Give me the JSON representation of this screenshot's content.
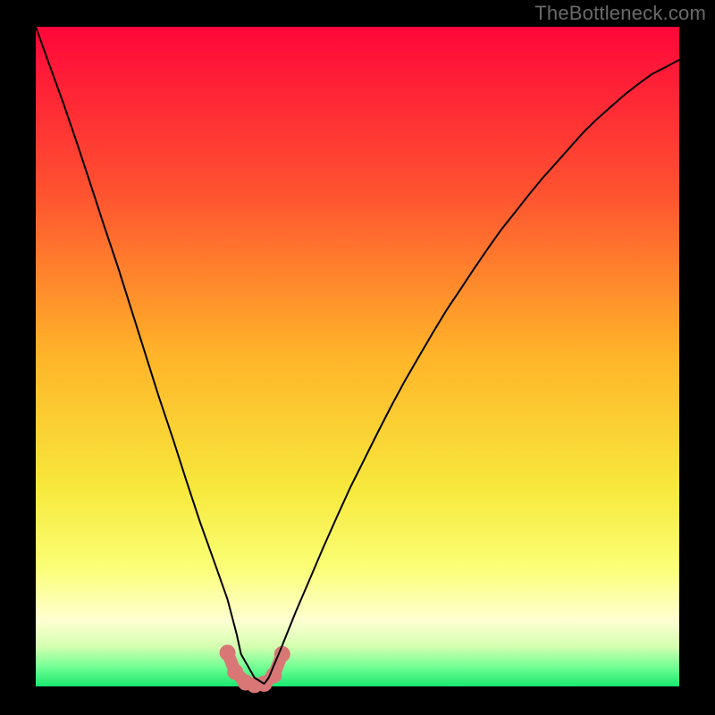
{
  "attribution": "TheBottleneck.com",
  "chart_data": {
    "type": "line",
    "title": "",
    "xlabel": "",
    "ylabel": "",
    "xlim": [
      0,
      100
    ],
    "ylim": [
      0,
      100
    ],
    "grid": false,
    "background_gradient": {
      "stops": [
        {
          "offset": 0.0,
          "color": "#ff063a"
        },
        {
          "offset": 0.25,
          "color": "#ff5230"
        },
        {
          "offset": 0.5,
          "color": "#ffb529"
        },
        {
          "offset": 0.7,
          "color": "#f7e83c"
        },
        {
          "offset": 0.82,
          "color": "#fbff76"
        },
        {
          "offset": 0.9,
          "color": "#feffd1"
        },
        {
          "offset": 0.94,
          "color": "#d3ffb0"
        },
        {
          "offset": 0.97,
          "color": "#74ff94"
        },
        {
          "offset": 1.0,
          "color": "#17e86f"
        }
      ]
    },
    "series": [
      {
        "name": "bottleneck-curve",
        "color": "#000000",
        "stroke_width": 2,
        "x": [
          0.0,
          2.1,
          4.3,
          6.4,
          8.5,
          10.6,
          12.8,
          14.9,
          17.0,
          19.1,
          21.3,
          23.4,
          25.5,
          27.7,
          29.8,
          31.2,
          31.9,
          34.0,
          35.5,
          36.2,
          38.3,
          40.4,
          42.6,
          44.7,
          46.8,
          48.9,
          51.1,
          53.2,
          55.3,
          57.4,
          59.6,
          61.7,
          63.8,
          66.0,
          68.1,
          70.2,
          72.3,
          74.5,
          76.6,
          78.7,
          80.9,
          83.0,
          85.1,
          87.2,
          89.4,
          91.5,
          93.6,
          95.7,
          97.9,
          100.0
        ],
        "y": [
          100.0,
          94.3,
          88.4,
          82.4,
          76.2,
          69.9,
          63.5,
          57.0,
          50.5,
          44.0,
          37.6,
          31.2,
          25.0,
          19.0,
          13.2,
          8.0,
          4.9,
          1.3,
          0.4,
          1.3,
          6.2,
          11.3,
          16.3,
          21.1,
          25.7,
          30.2,
          34.5,
          38.6,
          42.6,
          46.4,
          50.1,
          53.6,
          57.0,
          60.2,
          63.3,
          66.3,
          69.2,
          71.9,
          74.5,
          77.0,
          79.4,
          81.7,
          84.0,
          86.0,
          87.9,
          89.7,
          91.3,
          92.8,
          93.9,
          95.0
        ]
      },
      {
        "name": "markers",
        "color": "#d97676",
        "marker_radius": 9,
        "stroke_width": 14,
        "x": [
          29.8,
          31.0,
          32.6,
          34.0,
          35.5,
          37.0,
          38.3
        ],
        "y": [
          5.1,
          2.2,
          0.6,
          0.2,
          0.4,
          1.7,
          4.9
        ]
      }
    ]
  }
}
